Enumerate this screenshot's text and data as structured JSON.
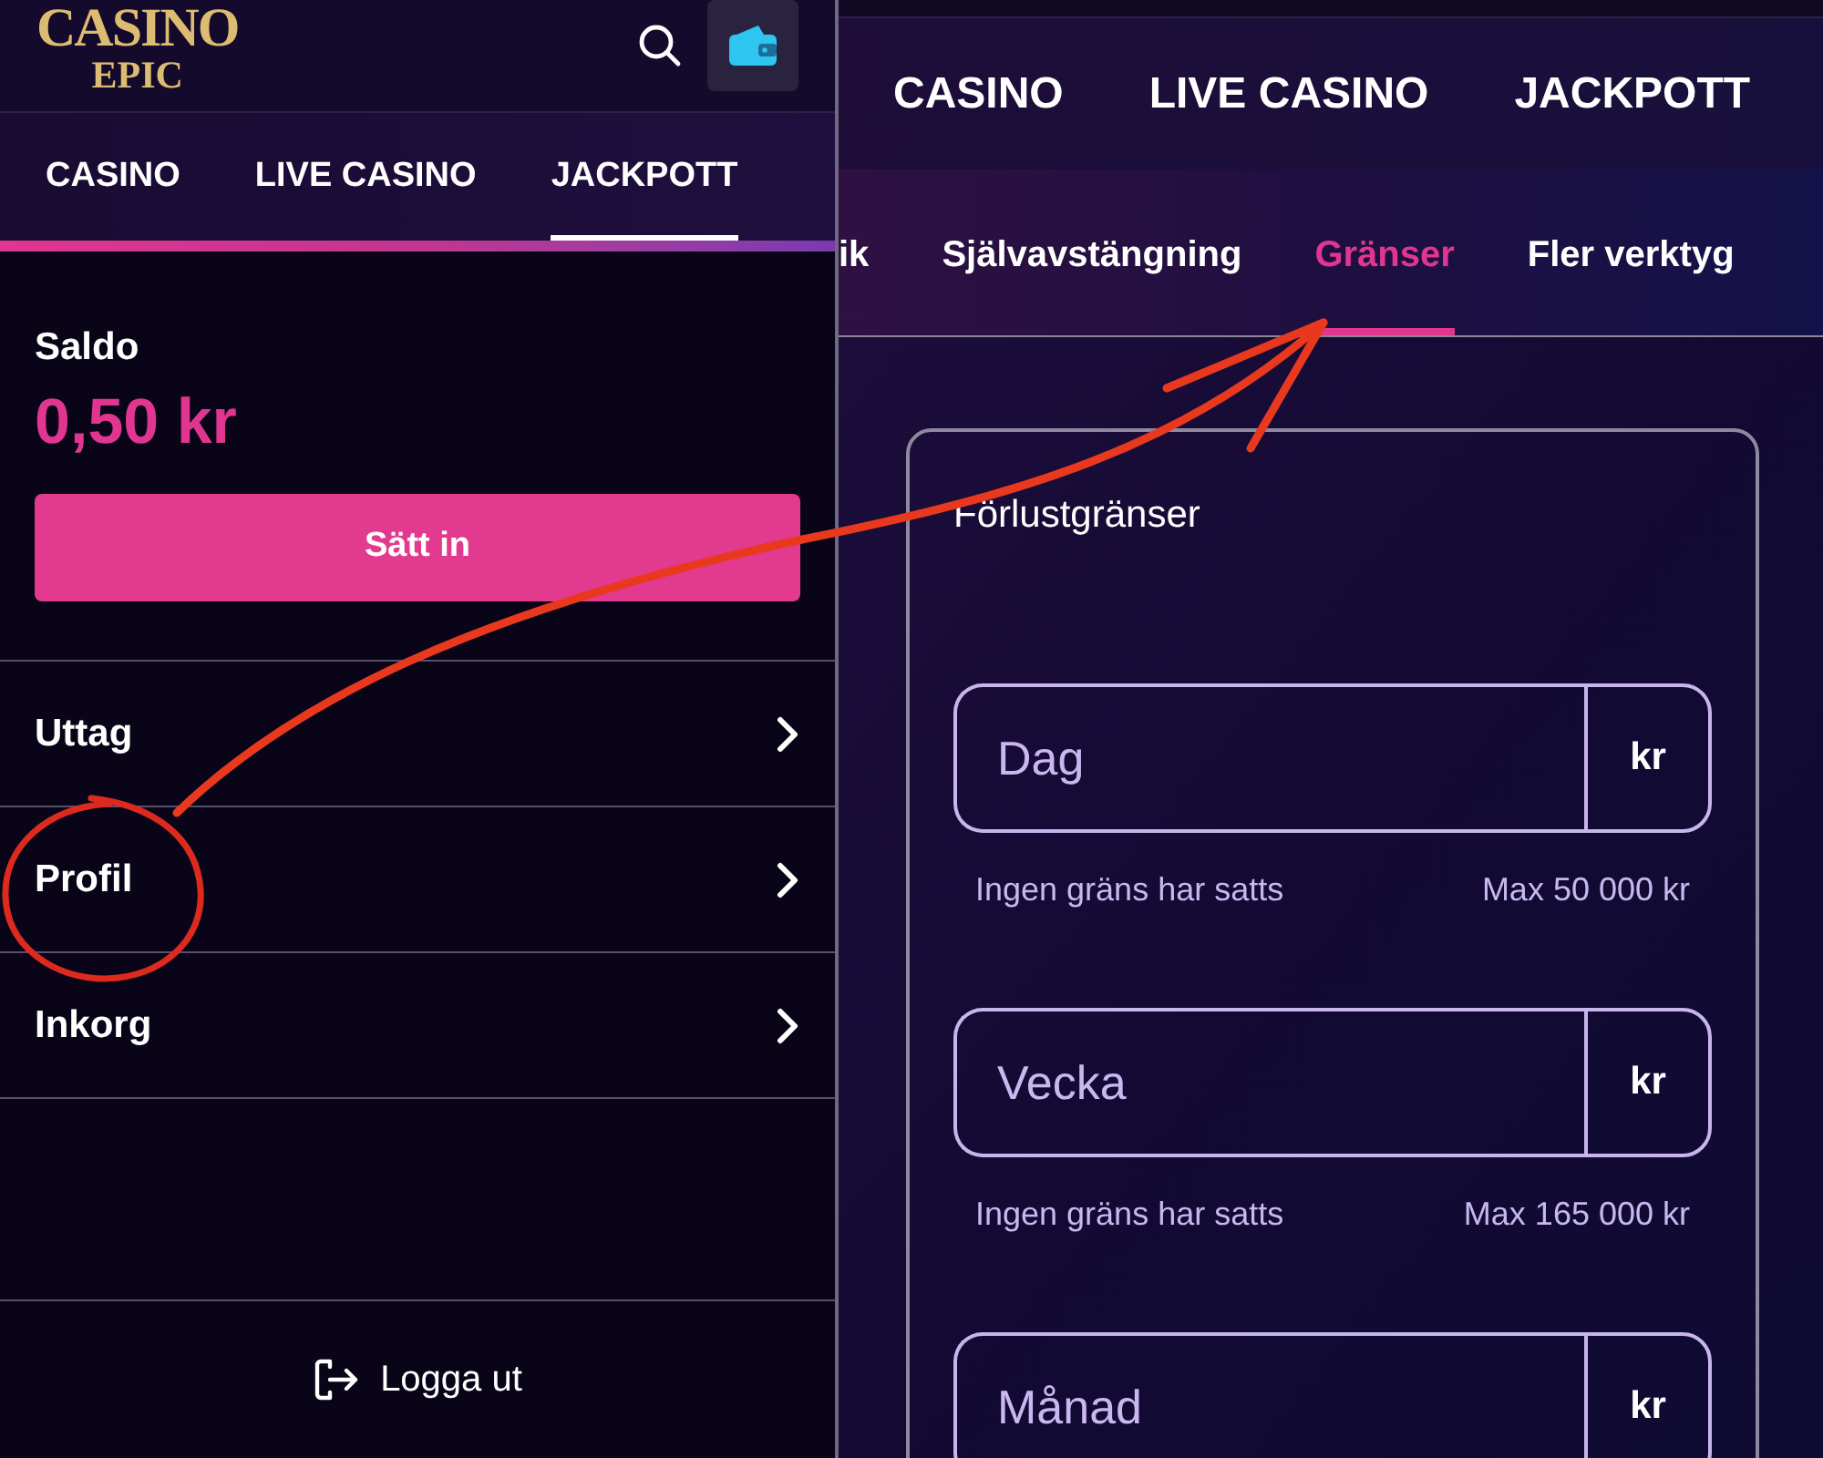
{
  "left_screen": {
    "header": {
      "logo": {
        "line_1": "CASINO",
        "line_2": "EPIC"
      }
    },
    "nav_tabs": [
      {
        "label": "CASINO",
        "selected": false
      },
      {
        "label": "LIVE CASINO",
        "selected": false
      },
      {
        "label": "JACKPOTT",
        "selected": true
      }
    ],
    "balance": {
      "label": "Saldo",
      "amount": "0,50 kr"
    },
    "deposit_button": "Sätt in",
    "menu_items": [
      {
        "label": "Uttag"
      },
      {
        "label": "Profil"
      },
      {
        "label": "Inkorg"
      }
    ],
    "logout_button": "Logga ut"
  },
  "right_screen": {
    "nav_tabs": [
      {
        "label": "CASINO",
        "selected": false
      },
      {
        "label": "LIVE CASINO",
        "selected": false
      },
      {
        "label": "JACKPOTT",
        "selected": false
      }
    ],
    "sub_tabs": [
      {
        "label": "ik",
        "selected": false
      },
      {
        "label": "Självavstängning",
        "selected": false
      },
      {
        "label": "Gränser",
        "selected": true
      },
      {
        "label": "Fler verktyg",
        "selected": false
      }
    ],
    "card": {
      "title": "Förlustgränser",
      "fields": [
        {
          "placeholder": "Dag",
          "unit": "kr",
          "status": "Ingen gräns har satts",
          "max": "Max 50 000 kr"
        },
        {
          "placeholder": "Vecka",
          "unit": "kr",
          "status": "Ingen gräns har satts",
          "max": "Max 165 000 kr"
        },
        {
          "placeholder": "Månad",
          "unit": "kr"
        }
      ]
    }
  }
}
